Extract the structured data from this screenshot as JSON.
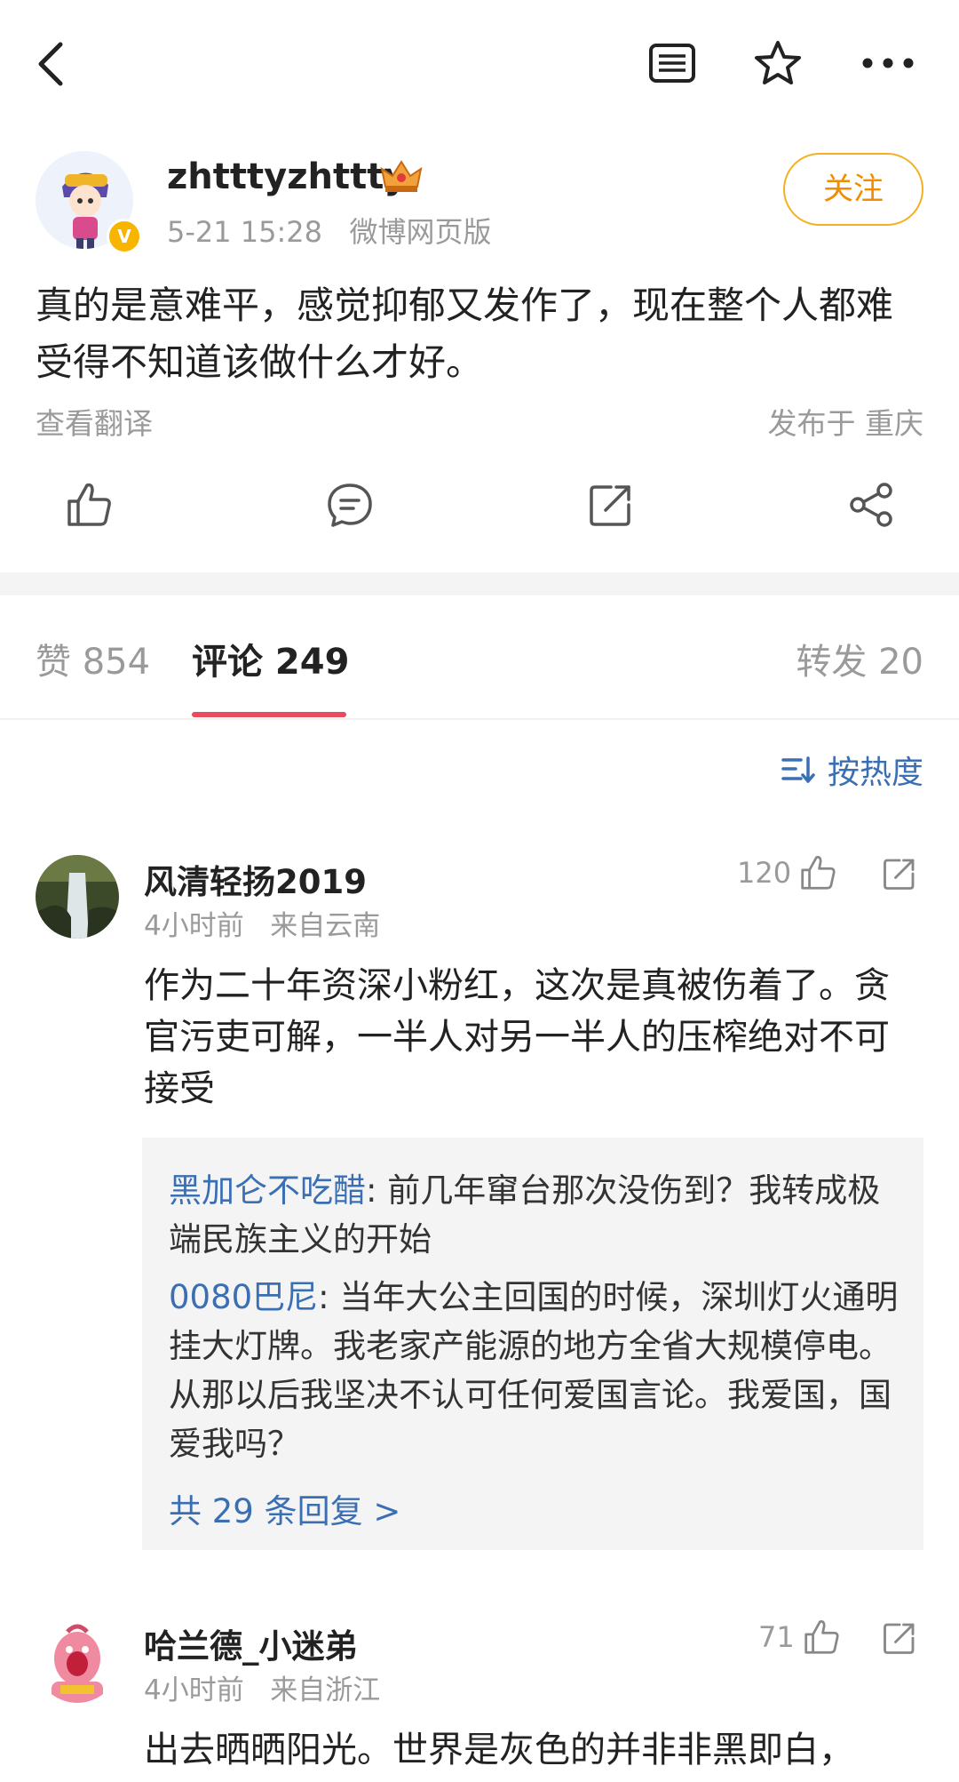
{
  "post": {
    "username": "zhtttyzhttty",
    "time": "5-21 15:28",
    "source": "微博网页版",
    "follow_label": "关注",
    "verified_badge": "V",
    "text": "真的是意难平，感觉抑郁又发作了，现在整个人都难受得不知道该做什么才好。",
    "translate_label": "查看翻译",
    "location": "发布于 重庆"
  },
  "tabs": {
    "likes": "赞 854",
    "comments": "评论 249",
    "reposts": "转发 20"
  },
  "sort_label": "按热度",
  "comments": [
    {
      "name": "风清轻扬2019",
      "time": "4小时前",
      "from": "来自云南",
      "likes": "120",
      "text": "作为二十年资深小粉红，这次是真被伤着了。贪官污吏可解，一半人对另一半人的压榨绝对不可接受",
      "replies": [
        {
          "name": "黑加仑不吃醋",
          "text": ": 前几年窜台那次没伤到？我转成极端民族主义的开始"
        },
        {
          "name": "0080巴尼",
          "text": ": 当年大公主回国的时候，深圳灯火通明挂大灯牌。我老家产能源的地方全省大规模停电。从那以后我坚决不认可任何爱国言论。我爱国，国爱我吗？"
        }
      ],
      "more_replies": "共 29 条回复 >"
    },
    {
      "name": "哈兰德_小迷弟",
      "time": "4小时前",
      "from": "来自浙江",
      "likes": "71",
      "text": "出去晒晒阳光。世界是灰色的并非非黑即白，"
    }
  ],
  "colors": {
    "accent_blue": "#3b6fb3",
    "tab_underline": "#ea4a5f",
    "follow_border": "#f5b021",
    "follow_text": "#f28c00"
  },
  "icons": {
    "back": "back-arrow-icon",
    "reader": "reader-mode-icon",
    "favorite": "star-icon",
    "more": "more-dots-icon",
    "like": "thumbs-up-icon",
    "comment": "comment-bubble-icon",
    "repost": "repost-icon",
    "share": "share-icon"
  }
}
